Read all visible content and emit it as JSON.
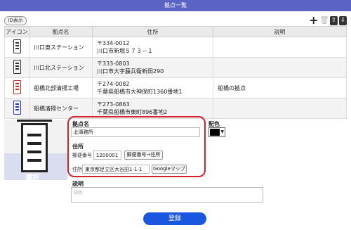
{
  "window": {
    "title": "拠点一覧"
  },
  "toolbar": {
    "id_toggle": "ID表示",
    "add": "+",
    "delete": "🗑",
    "move_up": "⇧",
    "move_down": "⇩"
  },
  "table": {
    "headers": [
      "アイコン",
      "拠点名",
      "住所",
      "説明"
    ],
    "rows": [
      {
        "name": "川口東ステーション",
        "zip": "〒334-0012",
        "addr": "川口市新堀５７３－１",
        "desc": "",
        "icon_color": "dark"
      },
      {
        "name": "川口北ステーション",
        "zip": "〒333-0803",
        "addr": "川口市大字藤兵衛新田290",
        "desc": "",
        "icon_color": "dark"
      },
      {
        "name": "船橋北部清掃工場",
        "zip": "〒274-0082",
        "addr": "千葉県船橋市大神保町1360番地1",
        "desc": "船橋の拠点",
        "icon_color": "red"
      },
      {
        "name": "船橋清掃センター",
        "zip": "〒273-0863",
        "addr": "千葉県船橋市東町896番地2",
        "desc": "",
        "icon_color": "blue"
      }
    ]
  },
  "form": {
    "image_label": "選択",
    "name_label": "拠点名",
    "name_value": "北事務所",
    "color_label": "配色",
    "color_value": "#000000",
    "address_section": "住所",
    "zip_label": "郵便番号",
    "zip_value": "1200001",
    "zip_to_address_button": "郵便番号→住所",
    "address_label": "住所",
    "address_value": "東京都足立区大谷田1-1-1",
    "google_map_button": "Googleマップ",
    "desc_label": "説明",
    "desc_placeholder": "説明",
    "register_button": "登録"
  }
}
